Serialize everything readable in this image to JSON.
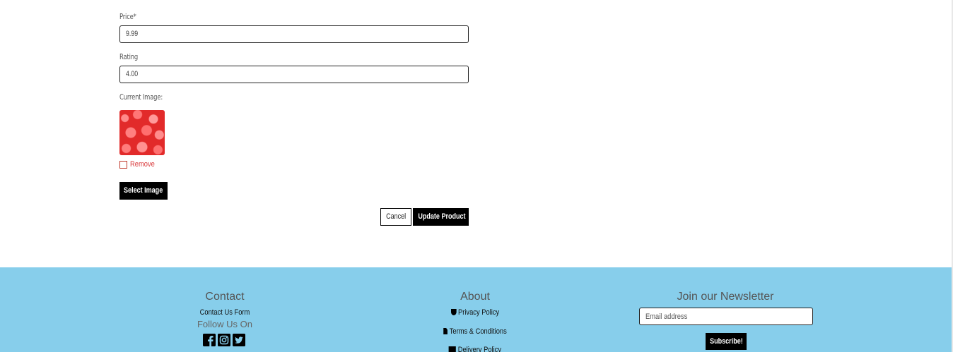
{
  "form": {
    "price_label": "Price*",
    "price_value": "9.99",
    "rating_label": "Rating",
    "rating_value": "4.00",
    "current_image_label": "Current Image:",
    "remove_label": "Remove",
    "select_image_label": "Select Image",
    "cancel_label": "Cancel",
    "update_label": "Update Product"
  },
  "footer": {
    "background": "#87ceeb",
    "contact": {
      "title": "Contact",
      "link": "Contact Us Form",
      "follow": "Follow Us On",
      "social_icons": [
        "facebook-icon",
        "instagram-icon",
        "twitter-icon"
      ]
    },
    "about": {
      "title": "About",
      "links": [
        {
          "icon": "shield-icon",
          "label": "Privacy Policy"
        },
        {
          "icon": "file-icon",
          "label": "Terms & Conditions"
        },
        {
          "icon": "truck-icon",
          "label": "Delivery Policy"
        }
      ]
    },
    "newsletter": {
      "title": "Join our Newsletter",
      "placeholder": "Email address",
      "button": "Subscribe!"
    }
  }
}
